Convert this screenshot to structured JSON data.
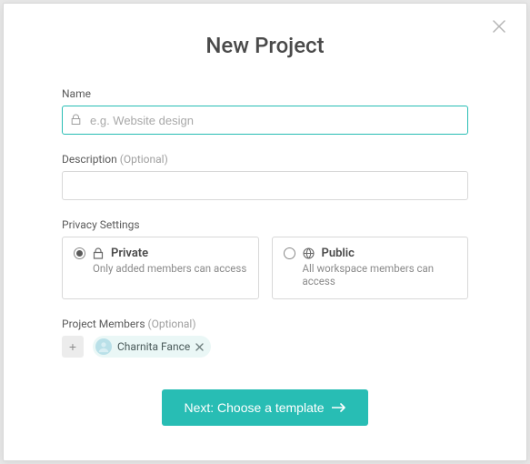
{
  "modal": {
    "title": "New Project",
    "close": "×"
  },
  "fields": {
    "name": {
      "label": "Name",
      "placeholder": "e.g. Website design",
      "value": ""
    },
    "description": {
      "label": "Description ",
      "optional": "(Optional)",
      "value": ""
    }
  },
  "privacy": {
    "label": "Privacy Settings",
    "options": [
      {
        "key": "private",
        "title": "Private",
        "subtitle": "Only added members can access",
        "selected": true,
        "icon": "lock-icon"
      },
      {
        "key": "public",
        "title": "Public",
        "subtitle": "All workspace members can access",
        "selected": false,
        "icon": "globe-icon"
      }
    ]
  },
  "members": {
    "label": "Project Members ",
    "optional": "(Optional)",
    "add": "+",
    "list": [
      {
        "name": "Charnita Fance"
      }
    ]
  },
  "footer": {
    "next": "Next: Choose a template"
  },
  "colors": {
    "accent": "#28bdb4"
  }
}
